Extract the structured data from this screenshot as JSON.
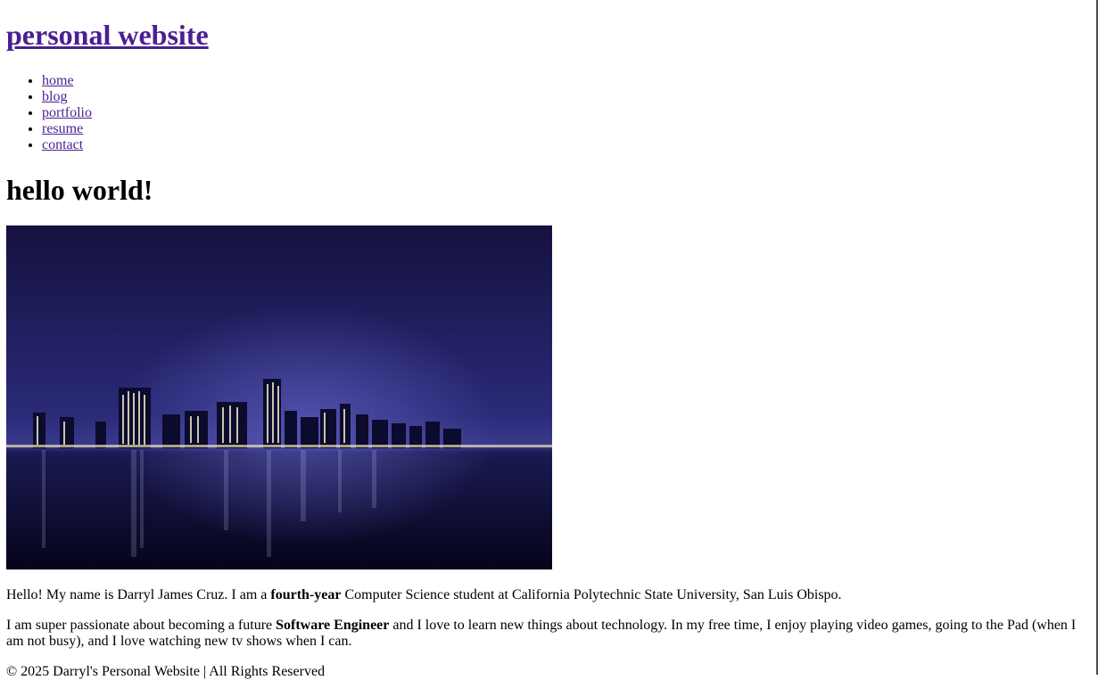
{
  "header": {
    "site_title": "personal website"
  },
  "nav": {
    "items": [
      {
        "label": "home"
      },
      {
        "label": "blog"
      },
      {
        "label": "portfolio"
      },
      {
        "label": "resume"
      },
      {
        "label": "contact"
      }
    ]
  },
  "main": {
    "heading": "hello world!",
    "hero_image_alt": "city skyline at night",
    "intro": {
      "part1": "Hello! My name is Darryl James Cruz. I am a ",
      "bold": "fourth-year",
      "part2": " Computer Science student at California Polytechnic State University, San Luis Obispo."
    },
    "more": {
      "part1": "I am super passionate about becoming a future ",
      "bold": "Software Engineer",
      "part2": " and I love to learn new things about technology. In my free time, I enjoy playing video games, going to the Pad (when I am not busy), and I love watching new tv shows when I can."
    }
  },
  "footer": {
    "text": "© 2025 Darryl's Personal Website | All Rights Reserved"
  },
  "colors": {
    "link": "#4b1f8f",
    "sky_top": "#1f1a5a",
    "sky_mid": "#2d2c78",
    "water": "#0b0a2a"
  }
}
